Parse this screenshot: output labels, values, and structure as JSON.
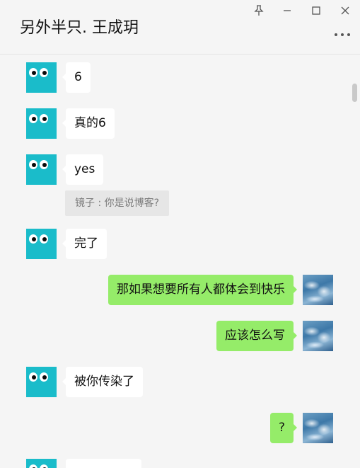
{
  "window": {
    "title": "另外半只. 王成玥",
    "pin_icon": "pin-icon",
    "minimize_icon": "minimize-icon",
    "maximize_icon": "maximize-icon",
    "close_icon": "close-icon",
    "more_icon": "more-dots-icon"
  },
  "colors": {
    "background": "#f5f5f5",
    "incoming_bubble": "#ffffff",
    "outgoing_bubble": "#95ec69",
    "avatar_teal": "#1abcca",
    "quote_bg": "#e6e6e6"
  },
  "messages": [
    {
      "side": "left",
      "text": "6"
    },
    {
      "side": "left",
      "text": "真的6"
    },
    {
      "side": "left",
      "text": "yes",
      "quote": "镜子 : 你是说博客?"
    },
    {
      "side": "left",
      "text": "完了"
    },
    {
      "side": "right",
      "text": "那如果想要所有人都体会到快乐"
    },
    {
      "side": "right",
      "text": "应该怎么写"
    },
    {
      "side": "left",
      "text": "被你传染了"
    },
    {
      "side": "right",
      "text": "?"
    },
    {
      "side": "left",
      "text": ""
    }
  ]
}
